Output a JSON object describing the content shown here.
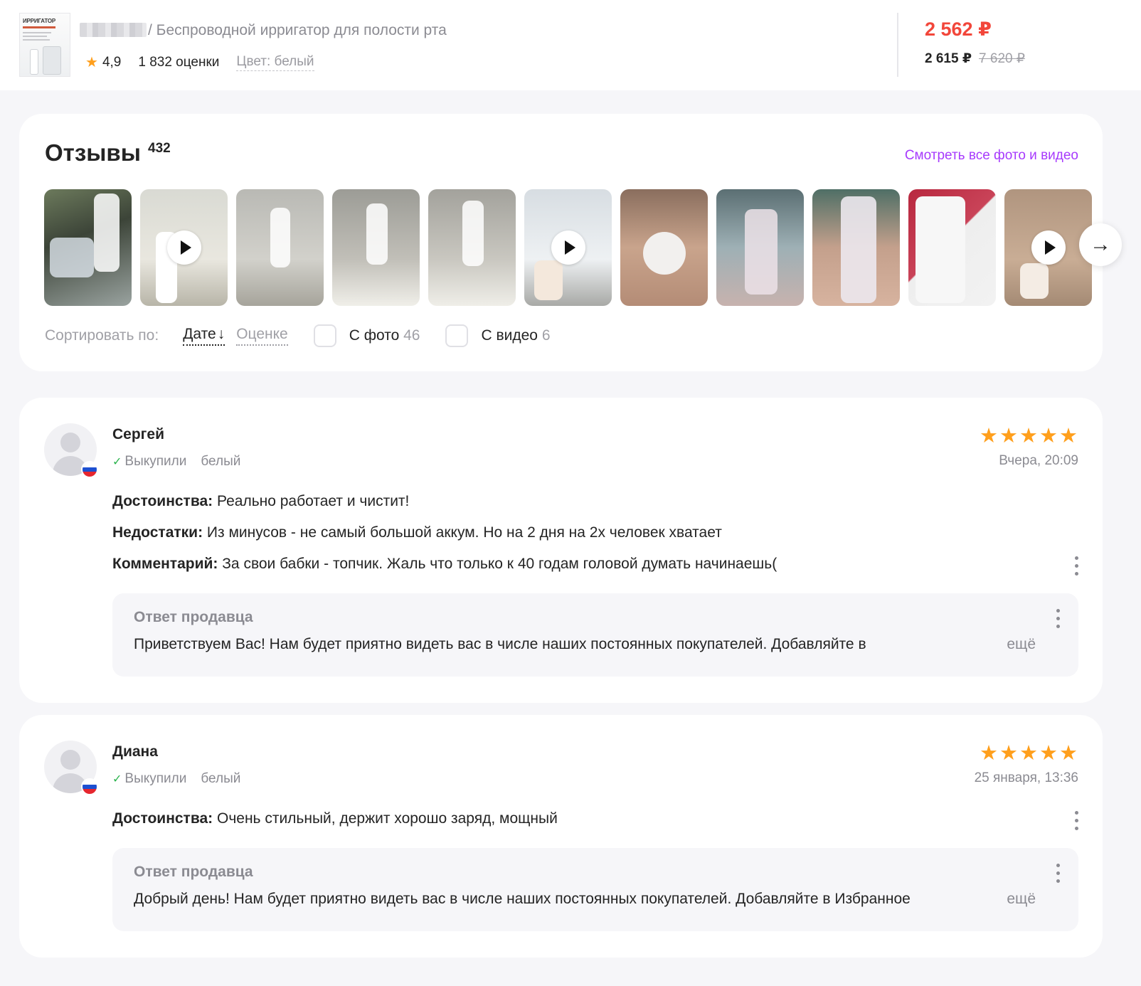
{
  "product": {
    "thumb_label": "ИРРИГАТОР",
    "title": "/ Беспроводной ирригатор для полости рта",
    "rating": "4,9",
    "ratings_count": "1 832 оценки",
    "color": "Цвет: белый",
    "price": "2 562 ₽",
    "price_wallet": "2 615 ₽",
    "price_old": "7 620 ₽"
  },
  "reviews_block": {
    "title": "Отзывы",
    "count": "432",
    "all_media_link": "Смотреть все фото и видео",
    "sort_label": "Сортировать по:",
    "sort_date": "Дате",
    "sort_arrow": "↓",
    "sort_score": "Оценке",
    "filter_photo": "С фото",
    "filter_photo_count": "46",
    "filter_video": "С видео",
    "filter_video_count": "6",
    "next_icon": "→"
  },
  "photos": [
    {
      "video": false
    },
    {
      "video": true
    },
    {
      "video": false
    },
    {
      "video": false
    },
    {
      "video": false
    },
    {
      "video": true
    },
    {
      "video": false
    },
    {
      "video": false
    },
    {
      "video": false
    },
    {
      "video": false
    },
    {
      "video": true
    }
  ],
  "reviews": [
    {
      "name": "Сергей",
      "bought": "Выкупили",
      "color": "белый",
      "stars": "★★★★★",
      "rating": 5,
      "date": "Вчера, 20:09",
      "pros_label": "Достоинства:",
      "pros": "Реально работает и чистит!",
      "cons_label": "Недостатки:",
      "cons": "Из минусов - не самый большой аккум. Но на 2 дня на 2х человек хватает",
      "comment_label": "Комментарий:",
      "comment": "За свои бабки - топчик. Жаль что только к 40 годам головой думать начинаешь(",
      "answer_title": "Ответ продавца",
      "answer_text": "Приветствуем Вас! Нам будет приятно видеть вас в числе наших постоянных покупателей. Добавляйте в",
      "answer_more": "ещё"
    },
    {
      "name": "Диана",
      "bought": "Выкупили",
      "color": "белый",
      "stars": "★★★★★",
      "rating": 5,
      "date": "25 января, 13:36",
      "pros_label": "Достоинства:",
      "pros": "Очень стильный, держит хорошо заряд, мощный",
      "answer_title": "Ответ продавца",
      "answer_text": "Добрый день! Нам будет приятно видеть вас в числе наших постоянных покупателей. Добавляйте в Избранное",
      "answer_more": "ещё"
    }
  ],
  "colors": {
    "accent": "#a73afd",
    "price": "#f2463a",
    "star": "#ff9f1c",
    "check": "#2bb34d"
  }
}
